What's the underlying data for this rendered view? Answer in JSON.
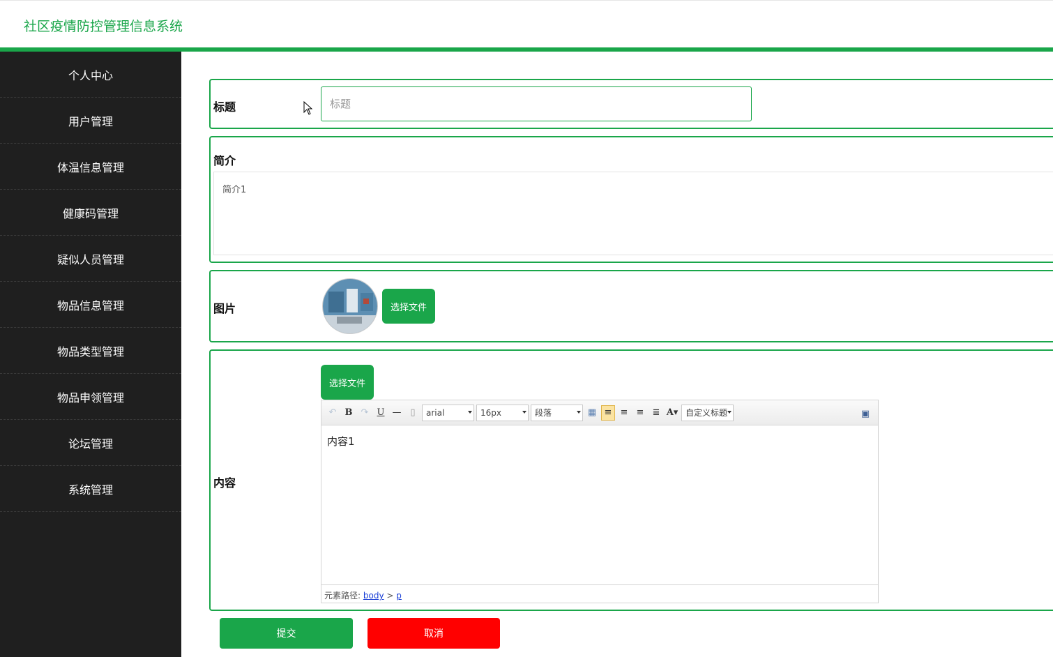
{
  "app": {
    "title": "社区疫情防控管理信息系统"
  },
  "sidebar": {
    "items": [
      {
        "label": "个人中心"
      },
      {
        "label": "用户管理"
      },
      {
        "label": "体温信息管理"
      },
      {
        "label": "健康码管理"
      },
      {
        "label": "疑似人员管理"
      },
      {
        "label": "物品信息管理"
      },
      {
        "label": "物品类型管理"
      },
      {
        "label": "物品申领管理"
      },
      {
        "label": "论坛管理"
      },
      {
        "label": "系统管理"
      }
    ]
  },
  "form": {
    "title": {
      "label": "标题",
      "placeholder": "标题",
      "value": ""
    },
    "intro": {
      "label": "简介",
      "value": "简介1"
    },
    "image": {
      "label": "图片",
      "button": "选择文件"
    },
    "content": {
      "label": "内容",
      "button": "选择文件",
      "toolbar": {
        "font_family": "arial",
        "font_size": "16px",
        "paragraph": "段落",
        "custom_title": "自定义标题"
      },
      "body": "内容1",
      "path_label": "元素路径:",
      "path_body": "body",
      "path_sep": ">",
      "path_p": "p"
    },
    "submit": "提交",
    "cancel": "取消"
  },
  "colors": {
    "accent": "#1aa64a",
    "danger": "#ff0000",
    "sidebar": "#1f1f1f"
  }
}
